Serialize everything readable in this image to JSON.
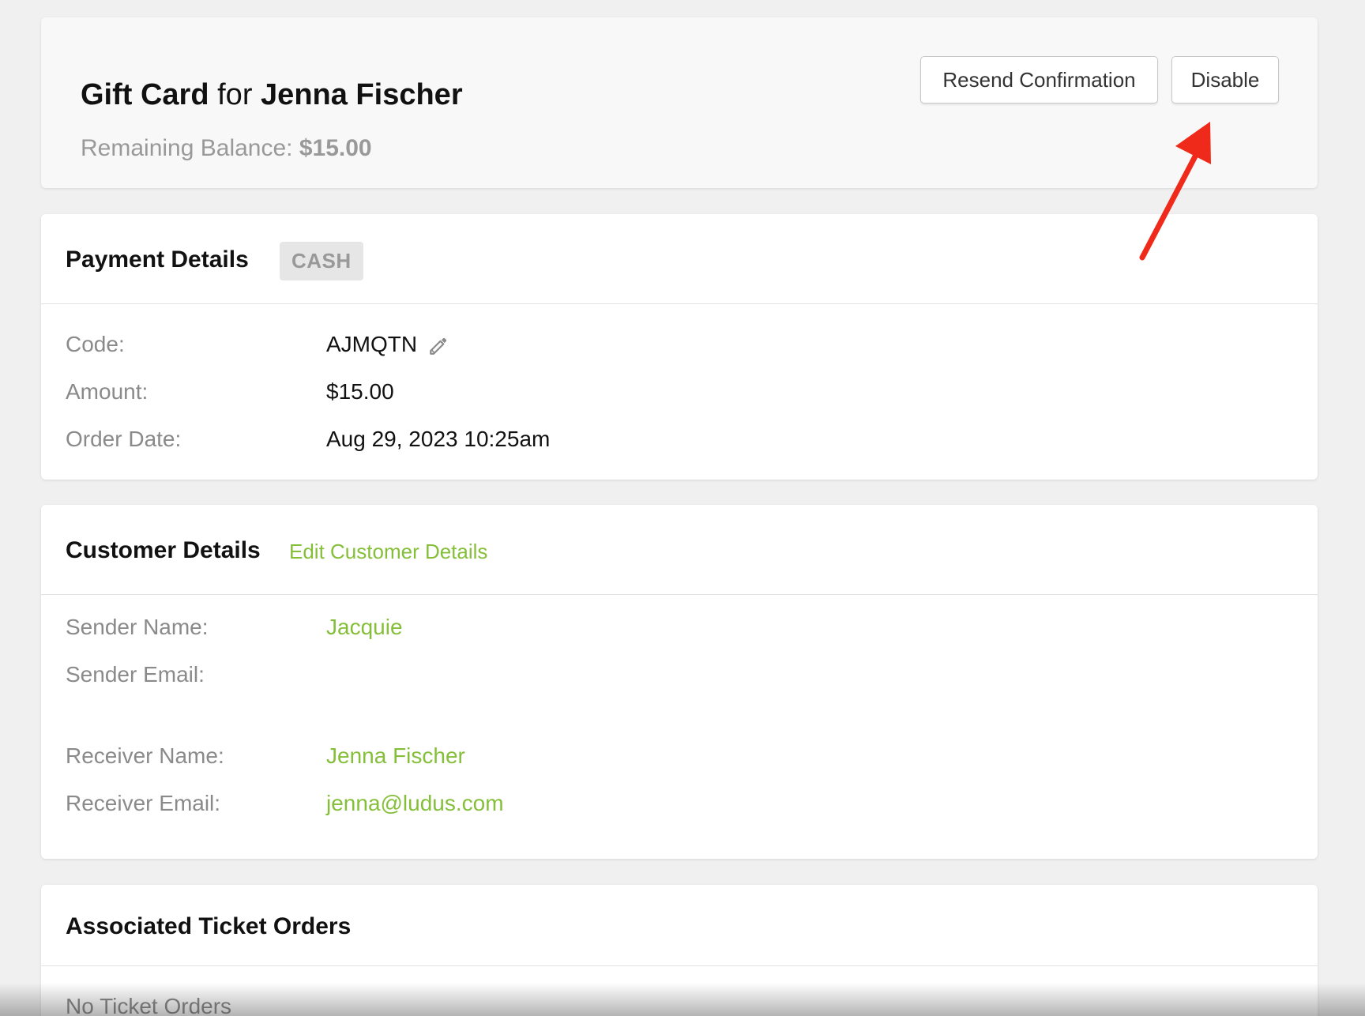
{
  "header": {
    "title_prefix": "Gift Card",
    "title_for": "for",
    "recipient": "Jenna Fischer",
    "balance_label": "Remaining Balance:",
    "balance_value": "$15.00",
    "resend_label": "Resend Confirmation",
    "disable_label": "Disable"
  },
  "payment": {
    "title": "Payment Details",
    "method_badge": "CASH",
    "rows": [
      {
        "label": "Code:",
        "value": "AJMQTN"
      },
      {
        "label": "Amount:",
        "value": "$15.00"
      },
      {
        "label": "Order Date:",
        "value": "Aug 29, 2023 10:25am"
      }
    ]
  },
  "customer": {
    "title": "Customer Details",
    "edit_link": "Edit Customer Details",
    "rows": [
      {
        "label": "Sender Name:",
        "value": "Jacquie"
      },
      {
        "label": "Sender Email:",
        "value": ""
      },
      {
        "label": "Receiver Name:",
        "value": "Jenna Fischer"
      },
      {
        "label": "Receiver Email:",
        "value": "jenna@ludus.com"
      }
    ]
  },
  "orders": {
    "title": "Associated Ticket Orders",
    "empty_text": "No Ticket Orders"
  },
  "colors": {
    "accent_green": "#85bf3a",
    "annotation_arrow": "#f02a1a",
    "muted_text": "#8a8a8a"
  },
  "icons": {
    "edit_code": "pencil-icon"
  }
}
